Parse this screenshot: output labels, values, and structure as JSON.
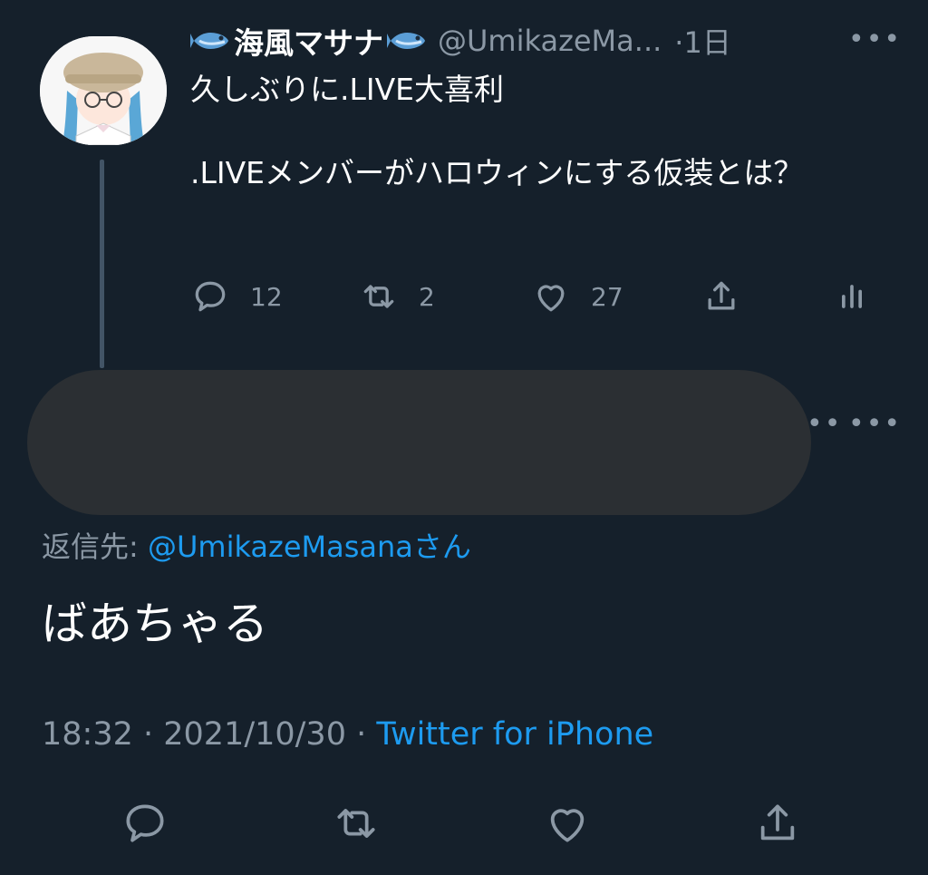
{
  "tweet": {
    "display_name": "海風マサナ",
    "handle": "@UmikazeMa...",
    "time": "·1日",
    "more": "•••",
    "text": "久しぶりに.LIVE大喜利\n\n.LIVEメンバーがハロウィンにする仮装とは？",
    "actions": {
      "reply_count": "12",
      "retweet_count": "2",
      "like_count": "27"
    }
  },
  "reply": {
    "more": "•••",
    "more_partial": "••",
    "reply_to_prefix": "返信先: ",
    "reply_to_handle": "@UmikazeMasana",
    "reply_to_suffix": "さん",
    "text": "ばあちゃる",
    "timestamp": "18:32 · 2021/10/30 · ",
    "source": "Twitter for iPhone"
  },
  "icons": [
    "fish-emoji-icon",
    "reply-icon",
    "retweet-icon",
    "like-icon",
    "share-icon",
    "analytics-icon",
    "more-icon"
  ],
  "colors": {
    "background": "#15202b",
    "secondary_text": "#8b98a5",
    "link": "#1d9bf0",
    "thread_line": "#425466",
    "redaction": "#2b2f33"
  }
}
